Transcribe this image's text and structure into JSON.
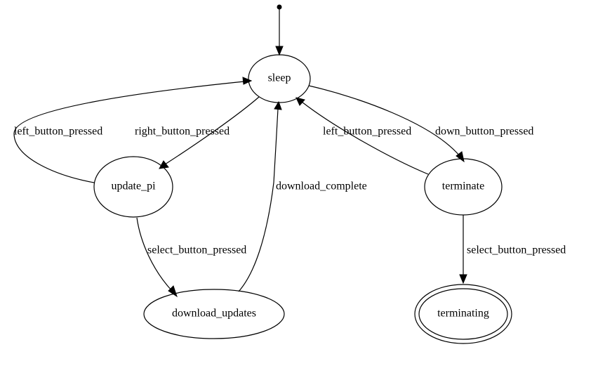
{
  "diagram": {
    "type": "state_machine",
    "states": {
      "sleep": {
        "label": "sleep",
        "accept": false
      },
      "update_pi": {
        "label": "update_pi",
        "accept": false
      },
      "download_updates": {
        "label": "download_updates",
        "accept": false
      },
      "terminate": {
        "label": "terminate",
        "accept": false
      },
      "terminating": {
        "label": "terminating",
        "accept": true
      }
    },
    "initial": "sleep",
    "transitions": [
      {
        "from": "sleep",
        "to": "update_pi",
        "label": "right_button_pressed"
      },
      {
        "from": "update_pi",
        "to": "sleep",
        "label": "left_button_pressed"
      },
      {
        "from": "update_pi",
        "to": "download_updates",
        "label": "select_button_pressed"
      },
      {
        "from": "download_updates",
        "to": "sleep",
        "label": "download_complete"
      },
      {
        "from": "sleep",
        "to": "terminate",
        "label": "down_button_pressed"
      },
      {
        "from": "terminate",
        "to": "sleep",
        "label": "left_button_pressed"
      },
      {
        "from": "terminate",
        "to": "terminating",
        "label": "select_button_pressed"
      }
    ]
  }
}
